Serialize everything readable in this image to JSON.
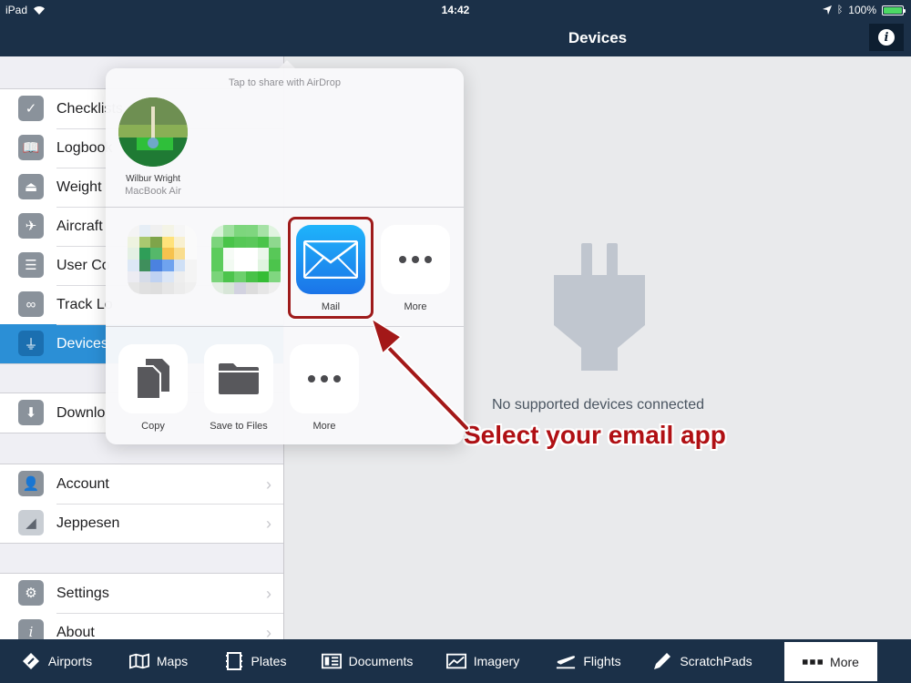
{
  "status": {
    "device": "iPad",
    "time": "14:42",
    "battery": "100%",
    "battery_level": 1.0
  },
  "nav": {
    "title": "Devices",
    "info_icon": "info-icon"
  },
  "sidebar": {
    "group1": [
      {
        "label": "Checklists",
        "icon": "checkmark-icon"
      },
      {
        "label": "Logbook",
        "icon": "book-icon"
      },
      {
        "label": "Weight",
        "icon": "weight-icon"
      },
      {
        "label": "Aircraft",
        "icon": "airplane-icon"
      },
      {
        "label": "User Co",
        "icon": "content-icon"
      },
      {
        "label": "Track Lo",
        "icon": "tracklog-icon"
      },
      {
        "label": "Devices",
        "icon": "plug-icon",
        "active": true
      }
    ],
    "group2": [
      {
        "label": "Downlo",
        "icon": "download-icon"
      }
    ],
    "group3": [
      {
        "label": "Account",
        "icon": "person-icon"
      },
      {
        "label": "Jeppesen",
        "icon": "jeppesen-icon"
      }
    ],
    "group4": [
      {
        "label": "Settings",
        "icon": "gear-icon"
      },
      {
        "label": "About",
        "icon": "info-icon"
      }
    ]
  },
  "main": {
    "empty_message": "No supported devices connected",
    "callout": "Select your email app"
  },
  "share": {
    "airdrop_hint": "Tap to share with AirDrop",
    "device": {
      "name": "Wilbur Wright",
      "model": "MacBook Air"
    },
    "apps": [
      {
        "label": "",
        "icon": "pixelated-app-icon"
      },
      {
        "label": "",
        "icon": "pixelated-app-icon"
      },
      {
        "label": "Mail",
        "icon": "mail-icon"
      },
      {
        "label": "More",
        "icon": "more-icon"
      }
    ],
    "actions": [
      {
        "label": "Copy",
        "icon": "copy-icon"
      },
      {
        "label": "Save to Files",
        "icon": "folder-icon"
      },
      {
        "label": "More",
        "icon": "more-icon"
      }
    ]
  },
  "tabs": [
    {
      "label": "Airports",
      "icon": "airport-icon"
    },
    {
      "label": "Maps",
      "icon": "map-icon"
    },
    {
      "label": "Plates",
      "icon": "plates-icon"
    },
    {
      "label": "Documents",
      "icon": "documents-icon"
    },
    {
      "label": "Imagery",
      "icon": "imagery-icon"
    },
    {
      "label": "Flights",
      "icon": "flights-icon"
    },
    {
      "label": "ScratchPads",
      "icon": "pencil-icon"
    },
    {
      "label": "More",
      "icon": "more-icon",
      "selected": true
    }
  ],
  "colors": {
    "nav": "#1b3048",
    "accent": "#2b8fd6",
    "callout": "#b01014"
  }
}
